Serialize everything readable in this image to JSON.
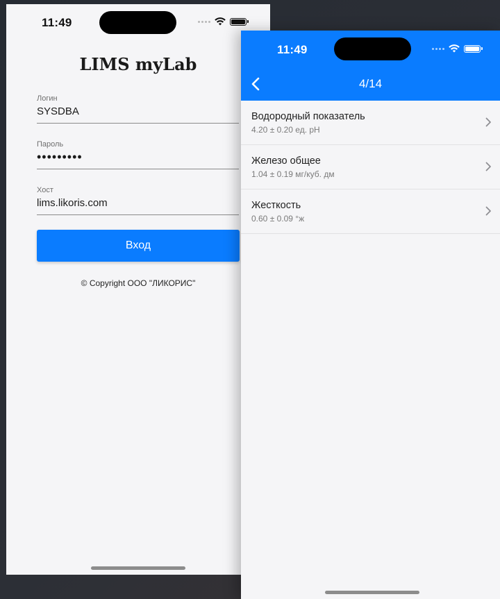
{
  "login_screen": {
    "status_time": "11:49",
    "app_title": "LIMS myLab",
    "fields": {
      "login": {
        "label": "Логин",
        "value": "SYSDBA"
      },
      "password": {
        "label": "Пароль",
        "value": "•••••••••"
      },
      "host": {
        "label": "Хост",
        "value": "lims.likoris.com"
      }
    },
    "login_button": "Вход",
    "copyright": "© Copyright ООО \"ЛИКОРИС\""
  },
  "list_screen": {
    "status_time": "11:49",
    "nav_title": "4/14",
    "items": [
      {
        "title": "Водородный показатель",
        "subtitle": "4.20 ± 0.20 ед. pH"
      },
      {
        "title": "Железо общее",
        "subtitle": "1.04 ± 0.19 мг/куб. дм"
      },
      {
        "title": "Жесткость",
        "subtitle": "0.60 ± 0.09 °ж"
      }
    ]
  },
  "colors": {
    "accent": "#0a7cff",
    "background": "#f5f5f7"
  },
  "icons": [
    "wifi-icon",
    "battery-icon",
    "signal-dots-icon",
    "back-chevron-icon",
    "chevron-right-icon"
  ]
}
